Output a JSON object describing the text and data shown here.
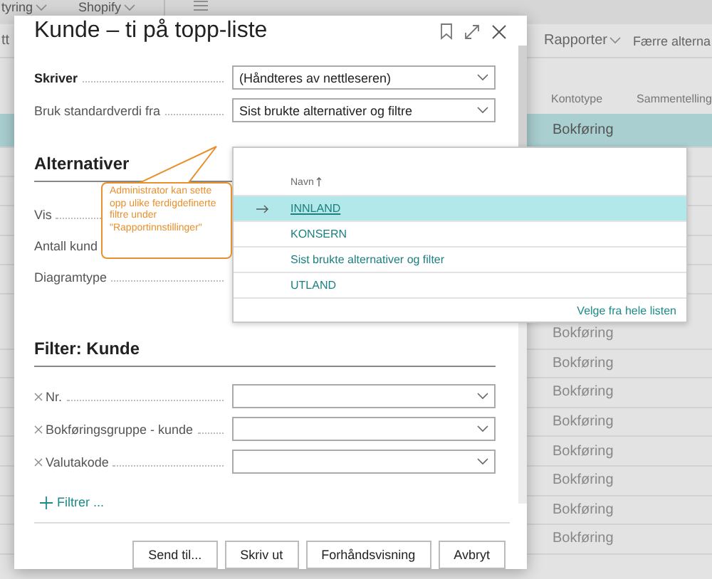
{
  "background": {
    "menu": [
      {
        "label": "tyring"
      },
      {
        "label": "Shopify"
      }
    ],
    "toolbar_left": "tt",
    "actions": [
      {
        "label": "Rapporter"
      }
    ],
    "more": "Færre alterna",
    "columns": [
      "Kontotype",
      "Sammentelling"
    ],
    "selected_row": {
      "type": "Bokføring",
      "selected": true
    },
    "rows": [
      {
        "type": "Bokføring",
        "selected": false
      },
      {
        "type": "Bokføring",
        "selected": false
      },
      {
        "type": "Bokføring",
        "selected": false
      },
      {
        "type": "Bokføring",
        "selected": false
      },
      {
        "type": "Bokføring",
        "selected": false
      },
      {
        "type": "Bokføring",
        "selected": false
      },
      {
        "type": "Bokføring",
        "selected": false
      },
      {
        "type": "Bokføring",
        "selected": false
      }
    ]
  },
  "dialog": {
    "title": "Kunde – ti på topp-liste",
    "fields": [
      {
        "label": "Skriver",
        "value": "(Håndteres av nettleseren)",
        "bold": true
      },
      {
        "label": "Bruk standardverdi fra",
        "value": "Sist brukte alternativer og filtre",
        "bold": false
      }
    ],
    "options_section": {
      "title": "Alternativer",
      "labels": [
        "Vis",
        "Antall kund",
        "Diagramtype"
      ]
    },
    "filter_section": {
      "title": "Filter: Kunde",
      "filters": [
        {
          "label": "Nr."
        },
        {
          "label": "Bokføringsgruppe - kunde"
        },
        {
          "label": "Valutakode"
        }
      ],
      "add_filter": "Filtrer ..."
    },
    "buttons": [
      "Send til...",
      "Skriv ut",
      "Forhåndsvisning",
      "Avbryt"
    ]
  },
  "lookup": {
    "column": "Navn",
    "items": [
      {
        "label": "INNLAND",
        "selected": true
      },
      {
        "label": "KONSERN",
        "selected": false
      },
      {
        "label": "Sist brukte alternativer og filter",
        "selected": false
      },
      {
        "label": "UTLAND",
        "selected": false
      }
    ],
    "footer_link": "Velge fra hele listen"
  },
  "callout": {
    "text": "Administrator kan sette opp ulike ferdigdefinerte filtre under \"Rapportinnstillinger\""
  }
}
